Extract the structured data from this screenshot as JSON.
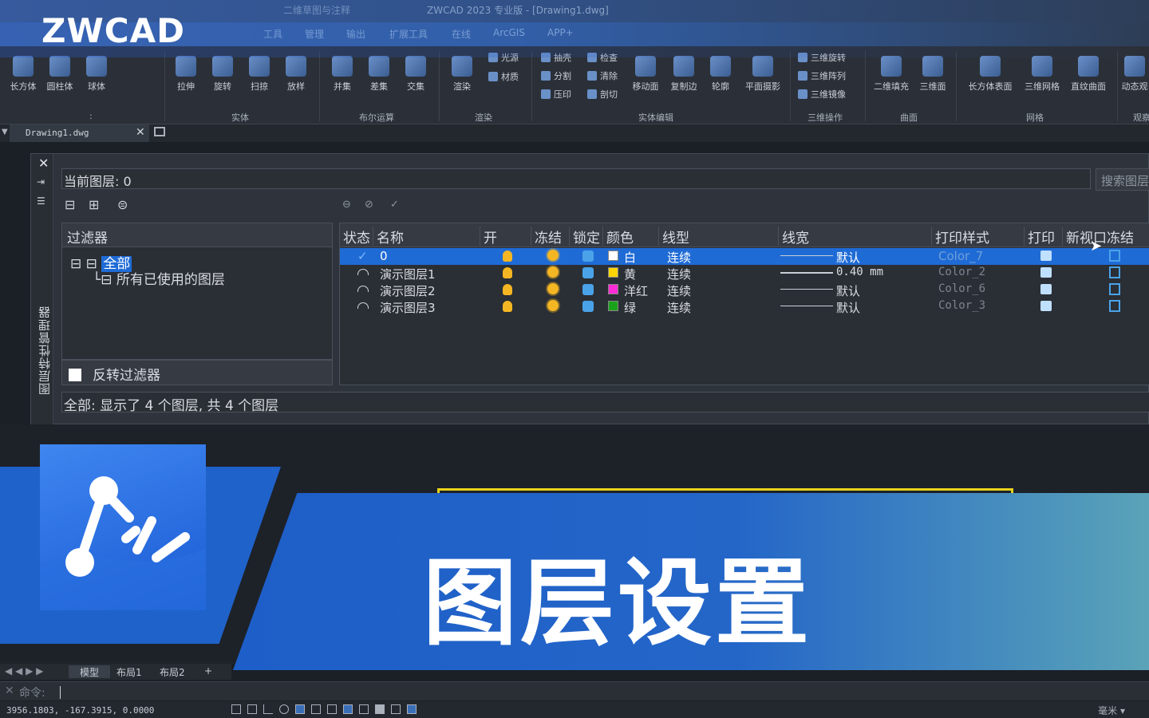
{
  "app": {
    "logo": "ZWCAD",
    "window_title": "ZWCAD 2023 专业版 - [Drawing1.dwg]",
    "workspace": "二维草图与注释"
  },
  "ribbon_tabs": [
    "工具",
    "管理",
    "输出",
    "扩展工具",
    "在线",
    "ArcGIS",
    "APP+"
  ],
  "ribbon": {
    "buttons": [
      "长方体",
      "圆柱体",
      "球体",
      "拉伸",
      "旋转",
      "扫掠",
      "放样",
      "并集",
      "差集",
      "交集",
      "渲染",
      "移动面",
      "复制边",
      "轮廓",
      "平面摄影",
      "二维填充",
      "三维面",
      "长方体表面",
      "三维网格",
      "直纹曲面",
      "动态观"
    ],
    "small_buttons": [
      "光源",
      "材质",
      "抽壳",
      "检查",
      "分割",
      "清除",
      "压印",
      "剖切",
      "三维旋转",
      "三维阵列",
      "三维镜像"
    ],
    "groups": [
      ":",
      "实体",
      "布尔运算",
      "渲染",
      "实体编辑",
      "三维操作",
      "曲面",
      "网格",
      "观察"
    ]
  },
  "document_tab": "Drawing1.dwg",
  "layer_manager": {
    "side_title": "图层特性管理器",
    "current_layer": "当前图层: 0",
    "search_placeholder": "搜索图层",
    "filters_header": "过滤器",
    "tree_all": "全部",
    "tree_used": "所有已使用的图层",
    "invert_filter": "反转过滤器",
    "columns": [
      "状态",
      "名称",
      "开",
      "冻结",
      "锁定",
      "颜色",
      "线型",
      "线宽",
      "打印样式",
      "打印",
      "新视口冻结"
    ],
    "layers": [
      {
        "name": "0",
        "color_name": "白",
        "color": "#ffffff",
        "linetype": "连续",
        "lineweight": "默认",
        "plot_style": "Color_7"
      },
      {
        "name": "演示图层1",
        "color_name": "黄",
        "color": "#ffd400",
        "linetype": "连续",
        "lineweight": "0.40 mm",
        "plot_style": "Color_2"
      },
      {
        "name": "演示图层2",
        "color_name": "洋红",
        "color": "#ff2bd6",
        "linetype": "连续",
        "lineweight": "默认",
        "plot_style": "Color_6"
      },
      {
        "name": "演示图层3",
        "color_name": "绿",
        "color": "#1aa31a",
        "linetype": "连续",
        "lineweight": "默认",
        "plot_style": "Color_3"
      }
    ],
    "status_text": "全部: 显示了 4 个图层, 共 4 个图层"
  },
  "banner": {
    "title": "图层设置"
  },
  "layout_tabs": [
    "模型",
    "布局1",
    "布局2",
    "+"
  ],
  "command_prompt": "命令:",
  "status": {
    "coordinates": "3956.1803,  -167.3915,  0.0000",
    "unit": "毫米"
  },
  "colors": {
    "accent": "#1f6bd6",
    "banner": "#1f62c9",
    "highlight_yellow": "#e8d21c"
  }
}
